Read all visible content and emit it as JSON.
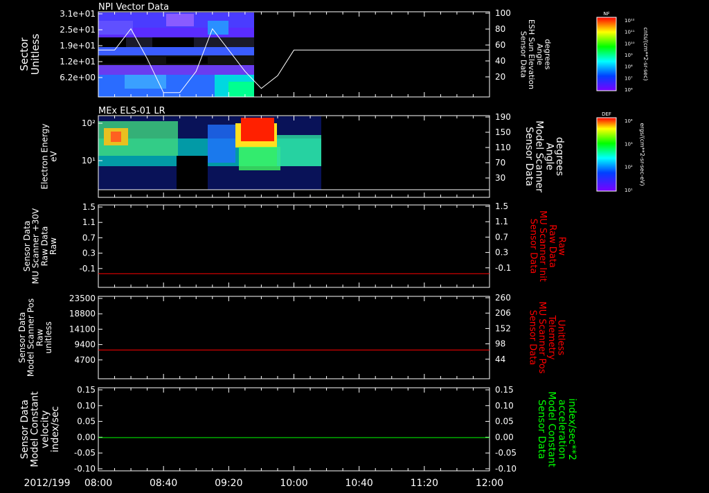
{
  "date_label": "2012/199",
  "time_ticks": [
    "08:00",
    "08:40",
    "09:20",
    "10:00",
    "10:40",
    "11:20",
    "12:00"
  ],
  "colors": {
    "white": "#ffffff",
    "red": "#ff0000",
    "green": "#00ff00",
    "black": "#000000"
  },
  "chart_data": [
    {
      "type": "heatmap",
      "title": "NPI Vector Data",
      "ylabel_left": [
        "Sector",
        "Unitless"
      ],
      "yticks_left": [
        "3.1e+01",
        "2.5e+01",
        "1.9e+01",
        "1.2e+01",
        "6.2e+00"
      ],
      "ylim_left": [
        0,
        31
      ],
      "ylabel_right": [
        "Sensor Data",
        "ESH Sun Elevation",
        "Angle",
        "degrees"
      ],
      "yticks_right": [
        "100",
        "80",
        "60",
        "40",
        "20"
      ],
      "ylim_right": [
        0,
        100
      ],
      "colorbar_label": "NF",
      "colorbar_ticks": [
        "10¹²",
        "10¹¹",
        "10¹⁰",
        "10⁹",
        "10⁸",
        "10⁷",
        "10⁶"
      ],
      "colorbar_units": "cnts/(cm**2-sr-sec)",
      "data_extent_time": [
        "08:00",
        "09:30"
      ],
      "series": [
        {
          "time": [
            "08:00",
            "08:10",
            "08:20",
            "08:30",
            "08:40",
            "08:50",
            "09:00",
            "09:10",
            "09:20",
            "09:30",
            "09:40",
            "09:50",
            "10:00",
            "10:10",
            "10:20",
            "11:00",
            "12:00"
          ],
          "values": [
            55,
            55,
            80,
            45,
            5,
            5,
            30,
            80,
            55,
            30,
            10,
            25,
            55,
            55,
            55,
            55,
            55
          ]
        }
      ]
    },
    {
      "type": "heatmap",
      "title": "MEx ELS-01 LR",
      "ylabel_left": [
        "Electron Energy",
        "eV"
      ],
      "yticks_left": [
        "10²",
        "10¹"
      ],
      "ylabel_right": [
        "Sensor Data",
        "Model Scanner",
        "Angle",
        "degrees"
      ],
      "yticks_right": [
        "190",
        "150",
        "110",
        "70",
        "30"
      ],
      "ylim_right": [
        0,
        190
      ],
      "colorbar_label": "DEF",
      "colorbar_ticks": [
        "10⁴",
        "10³",
        "10²",
        "10¹"
      ],
      "colorbar_units": "ergs/(cm**2-sr-sec-eV)",
      "data_extent_time": [
        "08:00",
        "10:20"
      ],
      "series": [
        {
          "time": [
            "08:00",
            "12:00"
          ],
          "values": [
            0,
            0
          ]
        }
      ]
    },
    {
      "type": "line",
      "ylabel_left": [
        "Sensor Data",
        "MU Scanner +30V",
        "Raw Data",
        "Raw"
      ],
      "yticks_left": [
        "1.5",
        "1.1",
        "0.7",
        "0.3",
        "-0.1"
      ],
      "ylim_left": [
        -0.3,
        1.5
      ],
      "ylabel_right": [
        "Sensor Data",
        "MU Scanner Init",
        "Raw Data",
        "Raw"
      ],
      "yticks_right": [
        "1.5",
        "1.1",
        "0.7",
        "0.3",
        "-0.1"
      ],
      "ylim_right": [
        -0.3,
        1.5
      ],
      "series": [
        {
          "time": [
            "08:00",
            "12:00"
          ],
          "values": [
            0,
            0
          ]
        }
      ]
    },
    {
      "type": "line",
      "ylabel_left": [
        "Sensor Data",
        "Model Scanner Pos",
        "Raw",
        "unitless"
      ],
      "yticks_left": [
        "23500",
        "18800",
        "14100",
        "9400",
        "4700"
      ],
      "ylim_left": [
        0,
        23500
      ],
      "ylabel_right": [
        "Sensor Data",
        "MU Scanner Pos",
        "Telemetry",
        "Unitless"
      ],
      "yticks_right": [
        "260",
        "206",
        "152",
        "98",
        "44"
      ],
      "ylim_right": [
        0,
        260
      ],
      "series": [
        {
          "time": [
            "08:00",
            "12:00"
          ],
          "values": [
            8200,
            8200
          ]
        }
      ]
    },
    {
      "type": "line",
      "ylabel_left": [
        "Sensor Data",
        "Model Constant",
        "velocity",
        "index/sec"
      ],
      "yticks_left": [
        "0.15",
        "0.10",
        "0.05",
        "0.00",
        "-0.05",
        "-0.10"
      ],
      "ylim_left": [
        -0.1,
        0.15
      ],
      "ylabel_right": [
        "Sensor Data",
        "Model Constant",
        "acceleration",
        "index/sec**2"
      ],
      "yticks_right": [
        "0.15",
        "0.10",
        "0.05",
        "0.00",
        "-0.05",
        "-0.10"
      ],
      "ylim_right": [
        -0.1,
        0.15
      ],
      "series": [
        {
          "time": [
            "08:00",
            "12:00"
          ],
          "values": [
            0,
            0
          ]
        }
      ]
    }
  ]
}
